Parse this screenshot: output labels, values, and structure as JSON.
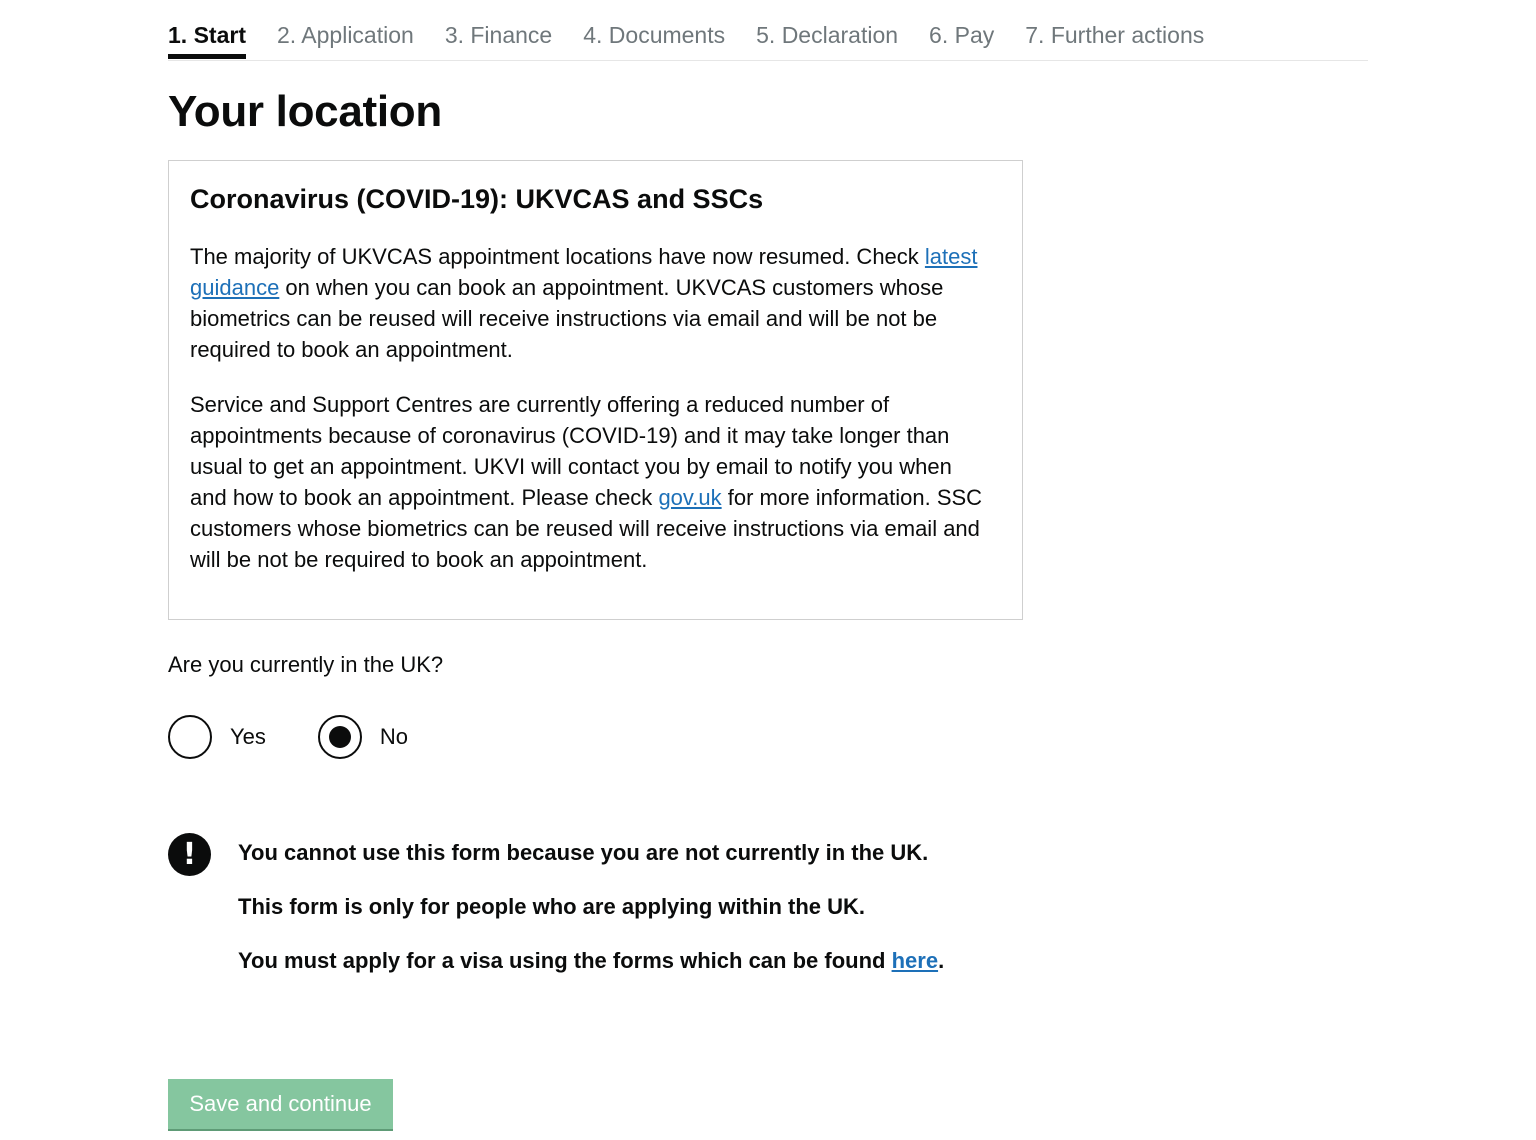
{
  "steps": [
    {
      "label": "1. Start",
      "active": true
    },
    {
      "label": "2. Application"
    },
    {
      "label": "3. Finance"
    },
    {
      "label": "4. Documents"
    },
    {
      "label": "5. Declaration"
    },
    {
      "label": "6. Pay"
    },
    {
      "label": "7. Further actions"
    }
  ],
  "page_title": "Your location",
  "notice": {
    "heading": "Coronavirus (COVID-19): UKVCAS and SSCs",
    "p1_before": "The majority of UKVCAS appointment locations have now resumed. Check ",
    "p1_link": "latest guidance",
    "p1_after": " on when you can book an appointment. UKVCAS customers whose biometrics can be reused will receive instructions via email and will be not be required to book an appointment.",
    "p2_before": "Service and Support Centres are currently offering a reduced number of appointments because of coronavirus (COVID-19) and it may take longer than usual to get an appointment. UKVI will contact you by email to notify you when and how to book an appointment. Please check ",
    "p2_link": "gov.uk",
    "p2_after": " for more information. SSC customers whose biometrics can be reused will receive instructions via email and will be not be required to book an appointment."
  },
  "question": {
    "label": "Are you currently in the UK?",
    "options": [
      {
        "label": "Yes",
        "selected": false
      },
      {
        "label": "No",
        "selected": true
      }
    ]
  },
  "warning": {
    "icon": "exclamation-icon",
    "line1": "You cannot use this form because you are not currently in the UK.",
    "line2": "This form is only for people who are applying within the UK.",
    "line3_before": "You must apply for a visa using the forms which can be found ",
    "line3_link": "here",
    "line3_after": "."
  },
  "submit_label": "Save and continue",
  "colors": {
    "link": "#1d70b8",
    "button_disabled": "#85c69f",
    "text": "#0b0c0c"
  }
}
